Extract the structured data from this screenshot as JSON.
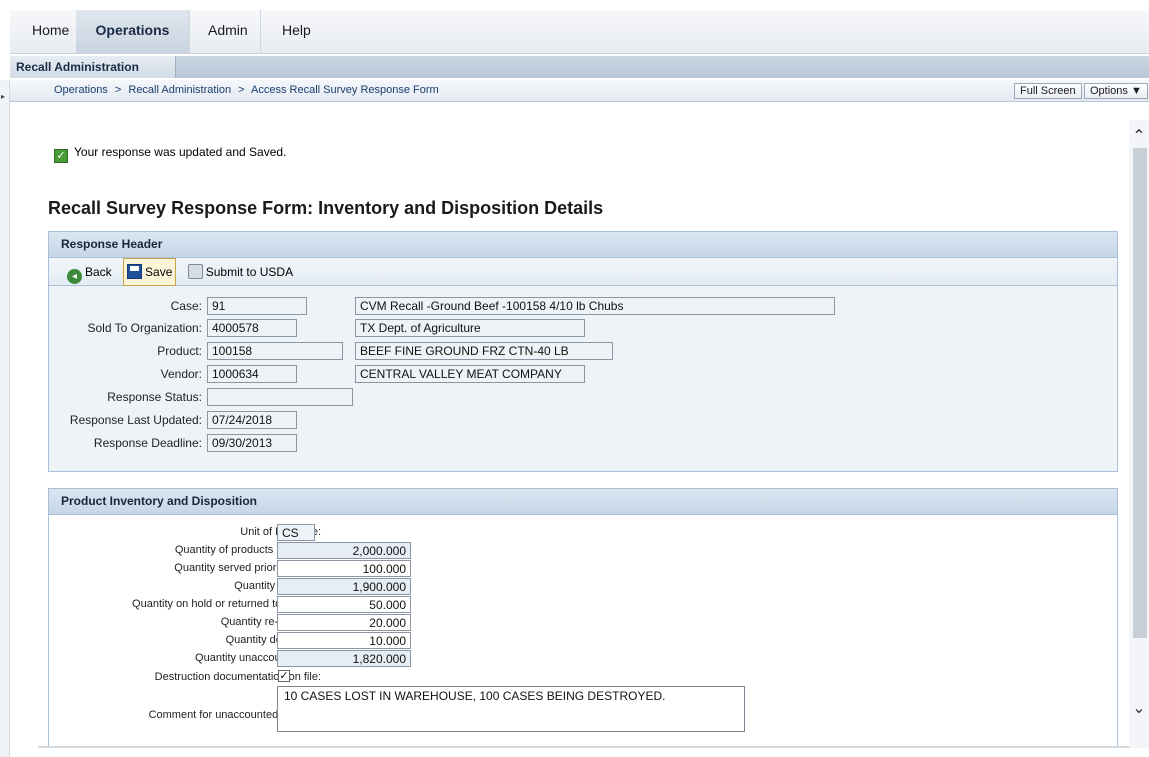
{
  "topnav": {
    "tabs": [
      {
        "label": "Home"
      },
      {
        "label": "Operations"
      },
      {
        "label": "Admin"
      },
      {
        "label": "Help"
      }
    ]
  },
  "subbar": {
    "tab_label": "Recall Administration"
  },
  "breadcrumb": {
    "items": [
      "Operations",
      "Recall Administration",
      "Access Recall Survey Response Form"
    ],
    "separator": ">"
  },
  "actions": {
    "full_screen": "Full Screen",
    "options": "Options ▼"
  },
  "message": {
    "text": "Your response was updated and Saved."
  },
  "page_title": "Recall Survey Response Form: Inventory and Disposition Details",
  "response_header": {
    "title": "Response Header",
    "toolbar": {
      "back": "Back",
      "save": "Save",
      "submit": "Submit to USDA"
    },
    "fields": {
      "case_label": "Case:",
      "case_value": "91",
      "case_desc": "CVM Recall -Ground Beef -100158 4/10 lb Chubs",
      "sold_to_label": "Sold To Organization:",
      "sold_to_value": "4000578",
      "sold_to_desc": "TX Dept. of Agriculture",
      "product_label": "Product:",
      "product_value": "100158",
      "product_desc": "BEEF FINE GROUND FRZ CTN-40 LB",
      "vendor_label": "Vendor:",
      "vendor_value": "1000634",
      "vendor_desc": "CENTRAL VALLEY MEAT COMPANY",
      "status_label": "Response Status:",
      "status_value": "",
      "updated_label": "Response Last Updated:",
      "updated_value": "07/24/2018",
      "deadline_label": "Response Deadline:",
      "deadline_value": "09/30/2013"
    }
  },
  "inventory": {
    "title": "Product Inventory and Disposition",
    "uom_label": "Unit of Measure:",
    "uom_value": "CS",
    "rows": [
      {
        "label": "Quantity of products received:",
        "value": "2,000.000"
      },
      {
        "label": "Quantity served prior to recall:",
        "value": "100.000"
      },
      {
        "label": "Quantity on hand:",
        "value": "1,900.000"
      },
      {
        "label": "Quantity on hold or returned to vendor:",
        "value": "50.000"
      },
      {
        "label": "Quantity re-donated:",
        "value": "20.000"
      },
      {
        "label": "Quantity destroyed:",
        "value": "10.000"
      },
      {
        "label": "Quantity unaccounted for:",
        "value": "1,820.000"
      }
    ],
    "destruction_label": "Destruction documentation on file:",
    "destruction_checked": true,
    "comment_label": "Comment for unaccounted product:",
    "comment_value": "10 CASES LOST IN WAREHOUSE, 100 CASES BEING DESTROYED."
  }
}
